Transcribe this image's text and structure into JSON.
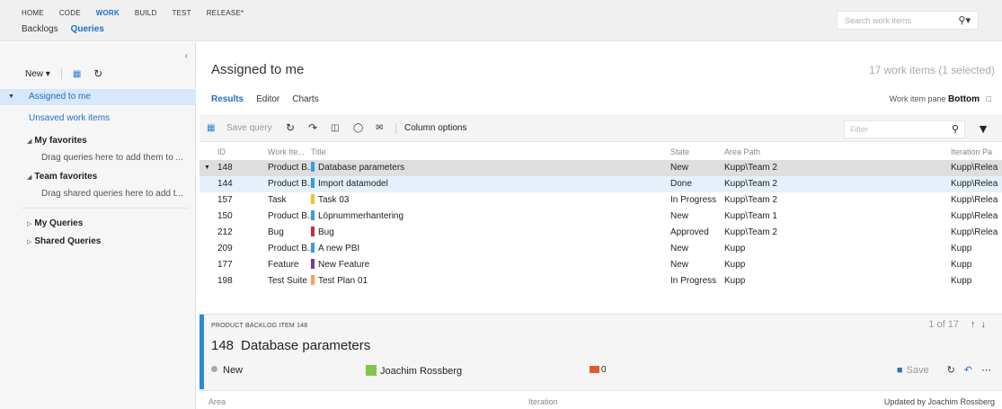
{
  "nav": {
    "hubs": [
      "HOME",
      "CODE",
      "WORK",
      "BUILD",
      "TEST",
      "RELEASE*"
    ],
    "active_hub": "WORK",
    "subhubs": [
      "Backlogs",
      "Queries"
    ],
    "active_subhub": "Queries",
    "search_placeholder": "Search work items"
  },
  "left": {
    "new_label": "New ▾",
    "selected_query": "Assigned to me",
    "unsaved_label": "Unsaved work items",
    "my_favorites": "My favorites",
    "my_favorites_hint": "Drag queries here to add them to ...",
    "team_favorites": "Team favorites",
    "team_favorites_hint": "Drag shared queries here to add t...",
    "my_queries": "My Queries",
    "shared_queries": "Shared Queries"
  },
  "main": {
    "title": "Assigned to me",
    "count": "17 work items (1 selected)",
    "tabs": [
      "Results",
      "Editor",
      "Charts"
    ],
    "active_tab": "Results",
    "pane_label": "Work item pane",
    "pane_value": "Bottom",
    "save_query": "Save query",
    "column_options": "Column options",
    "filter_placeholder": "Filter"
  },
  "grid": {
    "headers": [
      "ID",
      "Work Ite...",
      "Title",
      "State",
      "Area Path",
      "Iteration Pa"
    ],
    "rows": [
      {
        "id": "148",
        "type": "Product B...",
        "title": "Database parameters",
        "state": "New",
        "area": "Kupp\\Team 2",
        "iter": "Kupp\\Relea",
        "color": "#3a9bd9"
      },
      {
        "id": "144",
        "type": "Product B...",
        "title": "Import datamodel",
        "state": "Done",
        "area": "Kupp\\Team 2",
        "iter": "Kupp\\Relea",
        "color": "#3a9bd9"
      },
      {
        "id": "157",
        "type": "Task",
        "title": "Task 03",
        "state": "In Progress",
        "area": "Kupp\\Team 2",
        "iter": "Kupp\\Relea",
        "color": "#f2c12e"
      },
      {
        "id": "150",
        "type": "Product B...",
        "title": "Löpnummerhantering",
        "state": "New",
        "area": "Kupp\\Team 1",
        "iter": "Kupp\\Relea",
        "color": "#3a9bd9"
      },
      {
        "id": "212",
        "type": "Bug",
        "title": "Bug",
        "state": "Approved",
        "area": "Kupp\\Team 2",
        "iter": "Kupp\\Relea",
        "color": "#cc293d"
      },
      {
        "id": "209",
        "type": "Product B...",
        "title": "A new PBI",
        "state": "New",
        "area": "Kupp",
        "iter": "Kupp",
        "color": "#3a9bd9"
      },
      {
        "id": "177",
        "type": "Feature",
        "title": "New Feature",
        "state": "New",
        "area": "Kupp",
        "iter": "Kupp",
        "color": "#773b93"
      },
      {
        "id": "198",
        "type": "Test Suite",
        "title": "Test Plan 01",
        "state": "In Progress",
        "area": "Kupp",
        "iter": "Kupp",
        "color": "#f5a05a"
      }
    ]
  },
  "detail": {
    "type_label": "PRODUCT BACKLOG ITEM 148",
    "pager": "1 of 17",
    "id": "148",
    "title": "Database parameters",
    "state": "New",
    "assignee": "Joachim Rossberg",
    "comments": "0",
    "save_label": "Save",
    "area_label": "Area",
    "iteration_label": "Iteration",
    "updated": "Updated by Joachim Rossberg"
  }
}
